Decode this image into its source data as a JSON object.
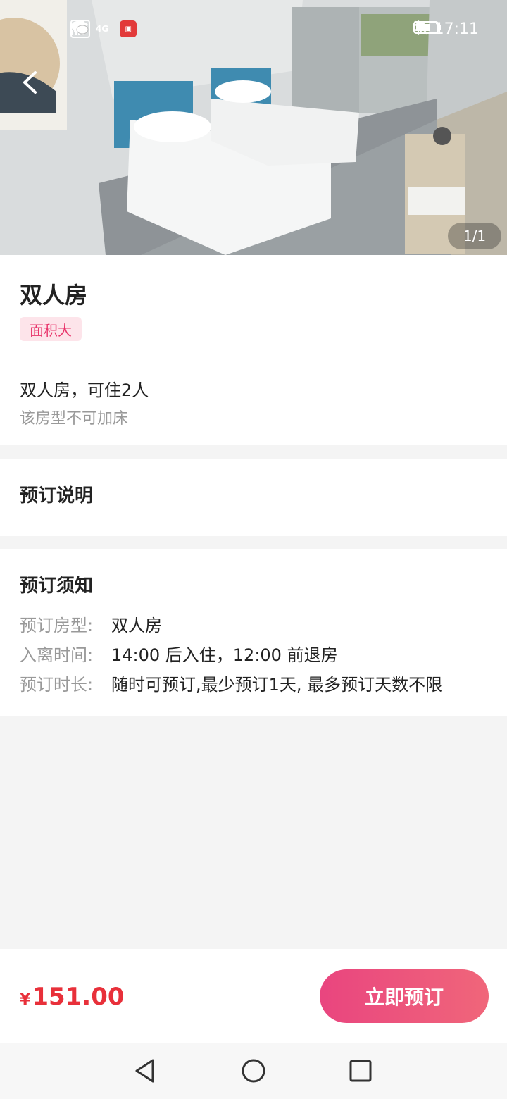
{
  "status_bar": {
    "network_label": "4G",
    "time": "17:11"
  },
  "gallery": {
    "counter": "1/1"
  },
  "room": {
    "name": "双人房",
    "tag": "面积大",
    "description": "双人房，可住2人",
    "extra_bed_note": "该房型不可加床"
  },
  "booking_explanation": {
    "title": "预订说明"
  },
  "booking_notice": {
    "title": "预订须知",
    "rows": [
      {
        "key": "预订房型:",
        "value": "双人房"
      },
      {
        "key": "入离时间:",
        "value": "14:00 后入住，12:00 前退房"
      },
      {
        "key": "预订时长:",
        "value": "随时可预订,最少预订1天, 最多预订天数不限"
      }
    ]
  },
  "footer": {
    "currency": "¥",
    "price": "151.00",
    "book_button": "立即预订"
  },
  "icons": {
    "back": "chevron-left-icon",
    "nav_back": "triangle-back-icon",
    "nav_home": "circle-home-icon",
    "nav_recent": "square-recent-icon"
  },
  "colors": {
    "accent": "#e8336a",
    "price": "#e8303a",
    "tag_bg": "#fde4ea"
  }
}
